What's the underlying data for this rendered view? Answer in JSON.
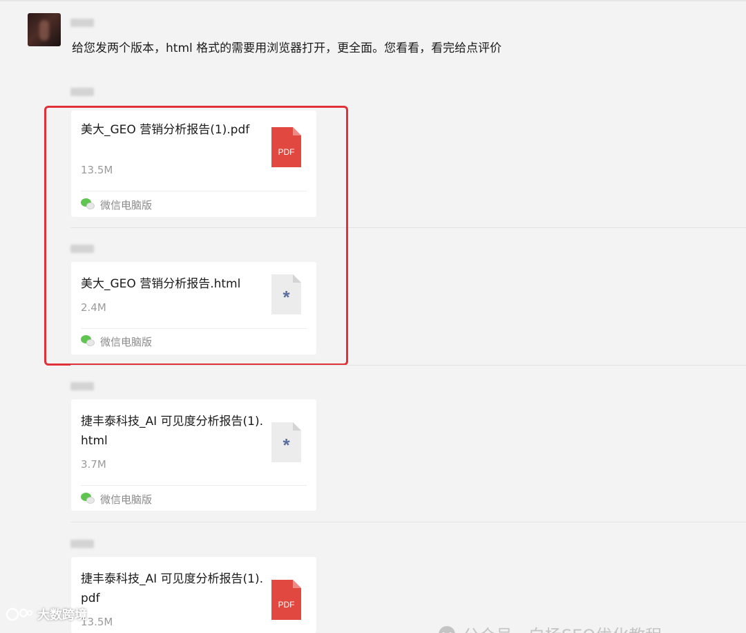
{
  "message": {
    "text": "给您发两个版本，html 格式的需要用浏览器打开，更全面。您看看，看完给点评价"
  },
  "files": [
    {
      "name": "美大_GEO 营销分析报告(1).pdf",
      "size": "13.5M",
      "type_icon": "PDF",
      "source": "微信电脑版"
    },
    {
      "name": "美大_GEO 营销分析报告.html",
      "size": "2.4M",
      "type_icon": "*",
      "source": "微信电脑版"
    },
    {
      "name": "捷丰泰科技_AI 可见度分析报告(1).html",
      "size": "3.7M",
      "type_icon": "*",
      "source": "微信电脑版"
    },
    {
      "name": "捷丰泰科技_AI 可见度分析报告(1).pdf",
      "size": "13.5M",
      "type_icon": "PDF",
      "source": ""
    }
  ],
  "watermarks": {
    "left": "大数跨境",
    "right": "公众号 · 白杨SEO优化教程"
  },
  "colors": {
    "background": "#f3f3f3",
    "card": "#ffffff",
    "pdf_red": "#e1483f",
    "highlight_red": "#e03138",
    "wechat_green": "#60c451"
  }
}
